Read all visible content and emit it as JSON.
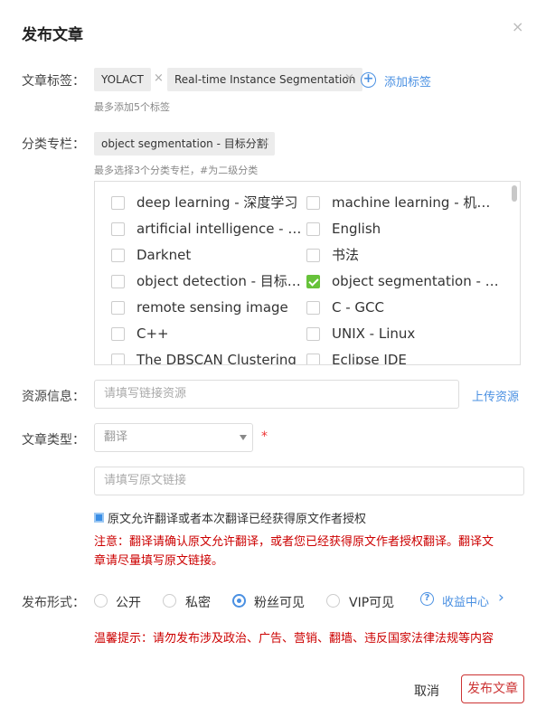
{
  "dialog": {
    "title": "发布文章",
    "close_icon": "×"
  },
  "tags": {
    "label": "文章标签：",
    "items": [
      "YOLACT",
      "Real-time Instance Segmentation"
    ],
    "remove_icon": "×",
    "add_label": "添加标签",
    "add_icon": "+",
    "hint": "最多添加5个标签"
  },
  "category": {
    "label": "分类专栏：",
    "selected": [
      "object segmentation - 目标分割"
    ],
    "remove_icon": "×",
    "hint": "最多选择3个分类专栏，#为二级分类",
    "options": [
      {
        "label": "deep learning - 深度学习",
        "checked": false
      },
      {
        "label": "machine learning - 机器学习",
        "checked": false
      },
      {
        "label": "artificial intelligence - 人工智能",
        "checked": false
      },
      {
        "label": "English",
        "checked": false
      },
      {
        "label": "Darknet",
        "checked": false
      },
      {
        "label": "书法",
        "checked": false
      },
      {
        "label": "object detection - 目标检测",
        "checked": false
      },
      {
        "label": "object segmentation - 目标分割",
        "checked": true
      },
      {
        "label": "remote sensing image",
        "checked": false
      },
      {
        "label": "C - GCC",
        "checked": false
      },
      {
        "label": "C++",
        "checked": false
      },
      {
        "label": "UNIX - Linux",
        "checked": false
      },
      {
        "label": "The DBSCAN Clustering",
        "checked": false
      },
      {
        "label": "Eclipse IDE",
        "checked": false
      }
    ]
  },
  "resource": {
    "label": "资源信息：",
    "placeholder": "请填写链接资源",
    "upload_label": "上传资源"
  },
  "article_type": {
    "label": "文章类型：",
    "selected": "翻译",
    "required_mark": "*",
    "source_placeholder": "请填写原文链接"
  },
  "authorization": {
    "text": "原文允许翻译或者本次翻译已经获得原文作者授权",
    "checked": true
  },
  "notice": {
    "line1": "注意：翻译请确认原文允许翻译，或者您已经获得原文作者授权翻译。翻译文",
    "line2": "章请尽量填写原文链接。"
  },
  "publish_form": {
    "label": "发布形式：",
    "options": [
      {
        "label": "公开",
        "checked": false
      },
      {
        "label": "私密",
        "checked": false
      },
      {
        "label": "粉丝可见",
        "checked": true
      },
      {
        "label": "VIP可见",
        "checked": false
      }
    ],
    "income_label": "收益中心",
    "income_chevron": "›",
    "help_icon": "?"
  },
  "warning_tip": "温馨提示：请勿发布涉及政治、广告、营销、翻墙、违反国家法律法规等内容",
  "buttons": {
    "cancel": "取消",
    "publish": "发布文章"
  },
  "colors": {
    "accent": "#4a90e2",
    "danger": "#cc0000",
    "checked_green": "#67c23a"
  }
}
